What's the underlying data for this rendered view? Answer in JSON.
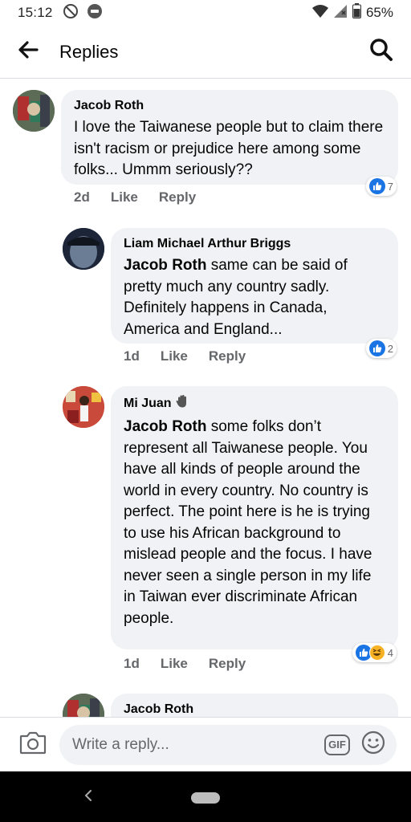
{
  "status_bar": {
    "time": "15:12",
    "battery": "65%"
  },
  "header": {
    "title": "Replies"
  },
  "comments": [
    {
      "author": "Jacob Roth",
      "mention": "",
      "text": "I love the Taiwanese people but to claim there isn't racism or prejudice here among some folks... Ummm seriously??",
      "time": "2d",
      "like_label": "Like",
      "reply_label": "Reply",
      "reaction_count": "7"
    },
    {
      "author": "Liam Michael Arthur Briggs",
      "mention": "Jacob Roth",
      "text": " same can be said of pretty much any country sadly. Definitely happens in Canada, America and England...",
      "time": "1d",
      "like_label": "Like",
      "reply_label": "Reply",
      "reaction_count": "2"
    },
    {
      "author": "Mi Juan",
      "mention": "Jacob Roth",
      "text": " some folks don’t represent all Taiwanese people. You have all kinds of people around the world in every country. No country is perfect. The point here is he is trying to use his African background to mislead people and the focus. I have never seen a single person in my life in Taiwan ever discriminate African people.",
      "time": "1d",
      "like_label": "Like",
      "reply_label": "Reply",
      "reaction_count": "4"
    },
    {
      "author": "Jacob Roth"
    }
  ],
  "composer": {
    "placeholder": "Write a reply...",
    "gif_label": "GIF"
  },
  "colors": {
    "bubble": "#f0f2f5",
    "like_blue": "#1b74e4",
    "secondary_text": "#65676b",
    "nav_bar": "#000000"
  },
  "icons": [
    "notification-off-icon",
    "line-app-icon",
    "wifi-icon",
    "signal-icon",
    "battery-icon",
    "back-arrow-icon",
    "search-icon",
    "like-reaction-icon",
    "haha-reaction-icon",
    "wave-hand-icon",
    "camera-icon",
    "gif-icon",
    "emoji-icon",
    "nav-back-icon",
    "nav-home-pill"
  ]
}
